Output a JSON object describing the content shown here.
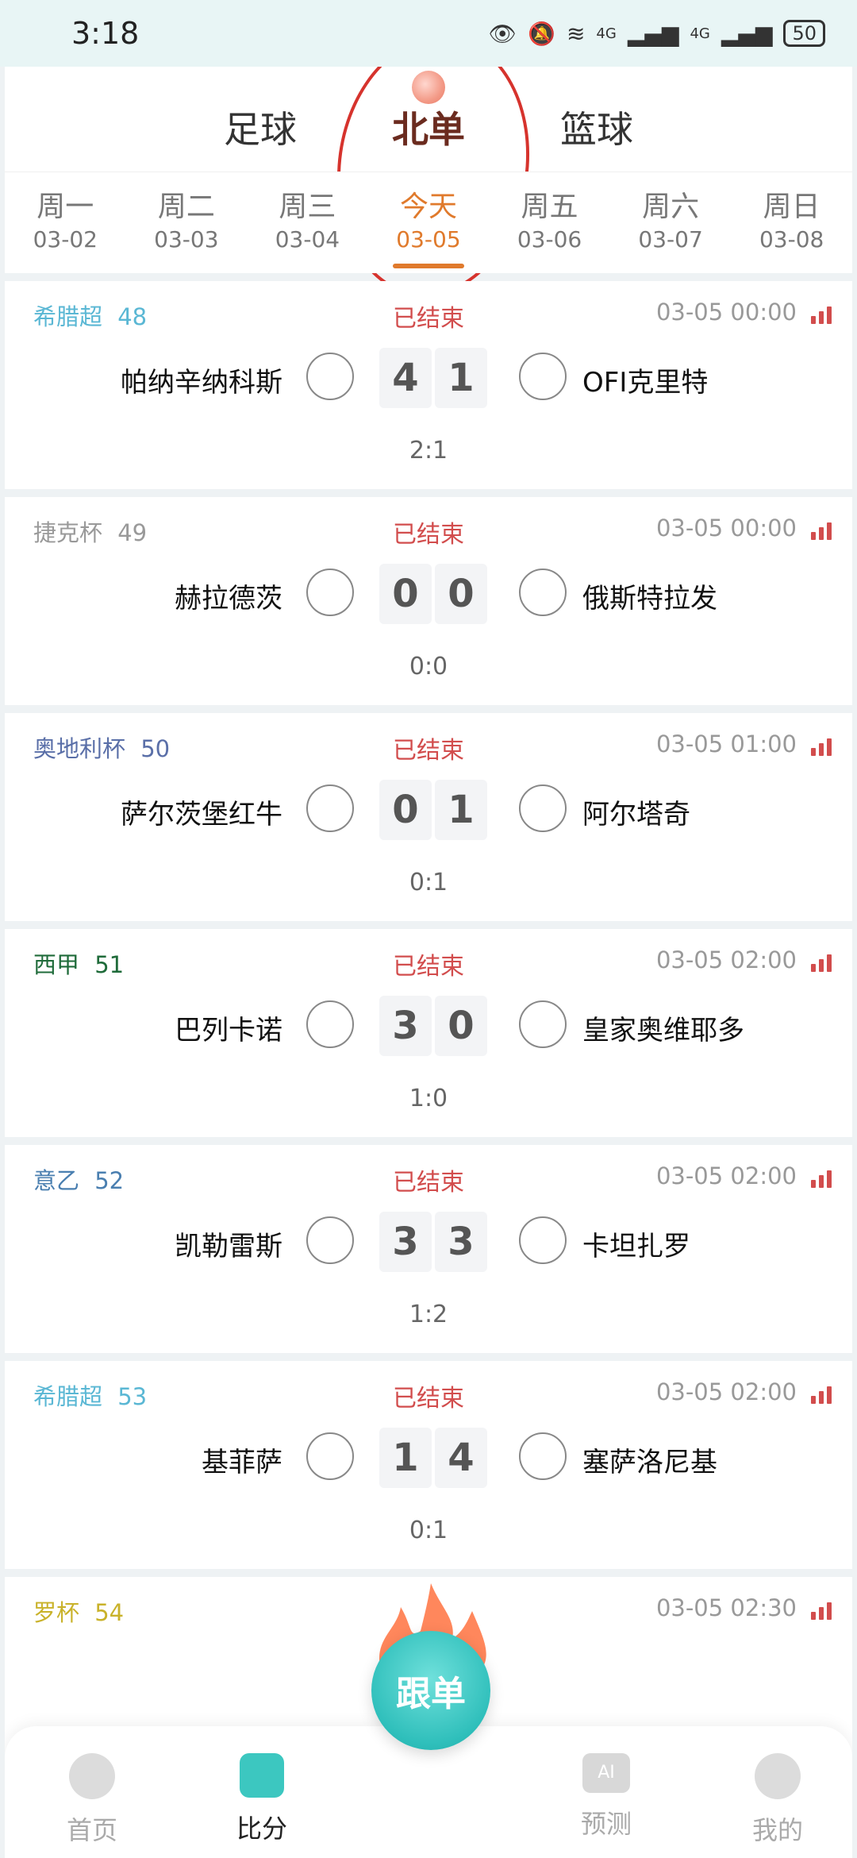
{
  "status_bar": {
    "time": "3:18",
    "signal_a": "4G",
    "signal_b": "4G",
    "battery": "50"
  },
  "sport_tabs": [
    {
      "label": "足球",
      "active": false
    },
    {
      "label": "北单",
      "active": true
    },
    {
      "label": "篮球",
      "active": false
    }
  ],
  "day_tabs": [
    {
      "name": "周一",
      "date": "03-02"
    },
    {
      "name": "周二",
      "date": "03-03"
    },
    {
      "name": "周三",
      "date": "03-04"
    },
    {
      "name": "今天",
      "date": "03-05",
      "active": true
    },
    {
      "name": "周五",
      "date": "03-06"
    },
    {
      "name": "周六",
      "date": "03-07"
    },
    {
      "name": "周日",
      "date": "03-08"
    }
  ],
  "matches": [
    {
      "league": "希腊超",
      "num": "48",
      "league_color": "#5ab7d4",
      "status": "已结束",
      "time": "03-05 00:00",
      "home": "帕纳辛纳科斯",
      "home_score": "4",
      "away_score": "1",
      "away": "OFI克里特",
      "half": "2:1"
    },
    {
      "league": "捷克杯",
      "num": "49",
      "league_color": "#999999",
      "status": "已结束",
      "time": "03-05 00:00",
      "home": "赫拉德茨",
      "home_score": "0",
      "away_score": "0",
      "away": "俄斯特拉发",
      "half": "0:0"
    },
    {
      "league": "奥地利杯",
      "num": "50",
      "league_color": "#5a6fa8",
      "status": "已结束",
      "time": "03-05 01:00",
      "home": "萨尔茨堡红牛",
      "home_score": "0",
      "away_score": "1",
      "away": "阿尔塔奇",
      "half": "0:1"
    },
    {
      "league": "西甲",
      "num": "51",
      "league_color": "#1f6b3a",
      "status": "已结束",
      "time": "03-05 02:00",
      "home": "巴列卡诺",
      "home_score": "3",
      "away_score": "0",
      "away": "皇家奥维耶多",
      "half": "1:0"
    },
    {
      "league": "意乙",
      "num": "52",
      "league_color": "#4a7fb0",
      "status": "已结束",
      "time": "03-05 02:00",
      "home": "凯勒雷斯",
      "home_score": "3",
      "away_score": "3",
      "away": "卡坦扎罗",
      "half": "1:2"
    },
    {
      "league": "希腊超",
      "num": "53",
      "league_color": "#5ab7d4",
      "status": "已结束",
      "time": "03-05 02:00",
      "home": "基菲萨",
      "home_score": "1",
      "away_score": "4",
      "away": "塞萨洛尼基",
      "half": "0:1"
    },
    {
      "league": "罗杯",
      "num": "54",
      "league_color": "#c9b22a",
      "status": "",
      "time": "03-05 02:30",
      "home": "",
      "home_score": "",
      "away_score": "",
      "away": "",
      "half": ""
    }
  ],
  "bottom_nav": [
    {
      "label": "首页",
      "icon": "soccer-ball-icon",
      "active": false
    },
    {
      "label": "比分",
      "icon": "score-icon",
      "active": true
    },
    {
      "label": "预测",
      "icon": "ai-icon",
      "active": false
    },
    {
      "label": "我的",
      "icon": "profile-icon",
      "active": false
    }
  ],
  "fab": {
    "label": "跟单",
    "icon": "flame-icon"
  },
  "ai_badge": "AI"
}
